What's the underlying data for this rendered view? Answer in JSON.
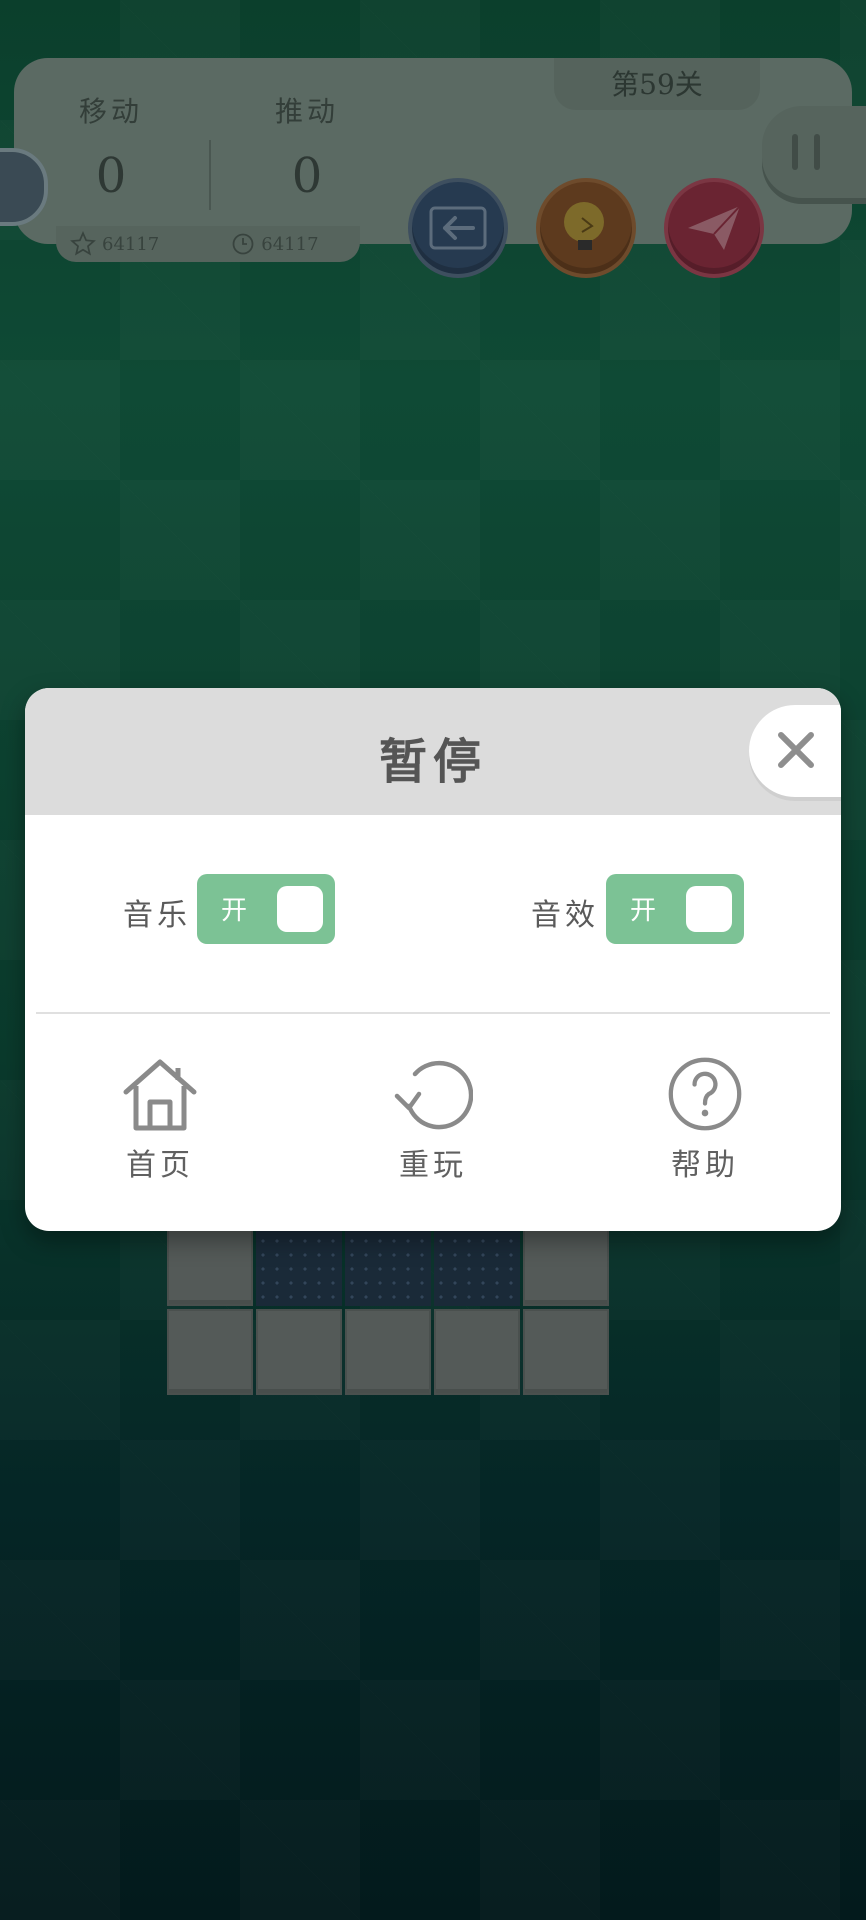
{
  "hud": {
    "level": "第59关",
    "moves_label": "移动",
    "moves_value": "0",
    "pushes_label": "推动",
    "pushes_value": "0",
    "star_record": "64117",
    "time_record": "64117"
  },
  "dialog": {
    "title": "暂停",
    "music_label": "音乐",
    "music_state": "开",
    "sfx_label": "音效",
    "sfx_state": "开",
    "home_label": "首页",
    "replay_label": "重玩",
    "help_label": "帮助"
  },
  "icons": {
    "back": "back-arrow-icon",
    "hint": "lightbulb-icon",
    "send": "paper-plane-icon",
    "pause": "pause-icon",
    "close": "close-icon",
    "home": "house-icon",
    "replay": "replay-icon",
    "help": "question-icon"
  },
  "colors": {
    "toggle_on": "#7cc295",
    "dialog_header": "#dcdcdc",
    "background_top": "#0f4a35",
    "background_bottom": "#031a1c"
  }
}
